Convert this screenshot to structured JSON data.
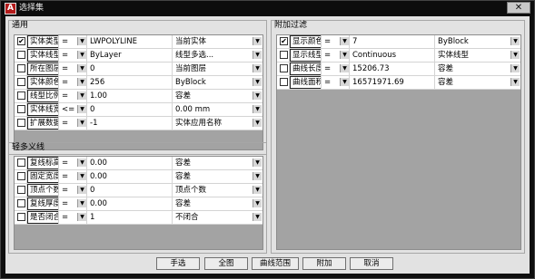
{
  "title": "选择集",
  "general": {
    "title": "通用",
    "rows": [
      {
        "checked": true,
        "property": "实体类型",
        "op": "=",
        "value": "LWPOLYLINE",
        "option": "当前实体"
      },
      {
        "checked": false,
        "property": "实体线型",
        "op": "=",
        "value": "ByLayer",
        "option": "线型多选..."
      },
      {
        "checked": false,
        "property": "所在图层",
        "op": "=",
        "value": "0",
        "option": "当前图层"
      },
      {
        "checked": false,
        "property": "实体颜色",
        "op": "=",
        "value": "256",
        "option": "ByBlock"
      },
      {
        "checked": false,
        "property": "线型比例",
        "op": "=",
        "value": "1.00",
        "option": "容差"
      },
      {
        "checked": false,
        "property": "实体线宽",
        "op": "<=",
        "value": "0",
        "option": "0.00 mm"
      },
      {
        "checked": false,
        "property": "扩展数据",
        "op": "=",
        "value": "-1",
        "option": "实体应用名称"
      }
    ]
  },
  "polyline": {
    "title": "轻多义线",
    "rows": [
      {
        "checked": false,
        "property": "复线标高",
        "op": "=",
        "value": "0.00",
        "option": "容差"
      },
      {
        "checked": false,
        "property": "固定宽度",
        "op": "=",
        "value": "0.00",
        "option": "容差"
      },
      {
        "checked": false,
        "property": "顶点个数",
        "op": "=",
        "value": "0",
        "option": "顶点个数"
      },
      {
        "checked": false,
        "property": "复线厚度",
        "op": "=",
        "value": "0.00",
        "option": "容差"
      },
      {
        "checked": false,
        "property": "是否闭合",
        "op": "=",
        "value": "1",
        "option": "不闭合"
      }
    ]
  },
  "extra": {
    "title": "附加过滤",
    "rows": [
      {
        "checked": true,
        "property": "显示颜色",
        "op": "=",
        "value": "7",
        "option": "ByBlock"
      },
      {
        "checked": false,
        "property": "显示线型",
        "op": "=",
        "value": "Continuous",
        "option": "实体线型"
      },
      {
        "checked": false,
        "property": "曲线长度",
        "op": "=",
        "value": "15206.73",
        "option": "容差"
      },
      {
        "checked": false,
        "property": "曲线面积",
        "op": "=",
        "value": "16571971.69",
        "option": "容差"
      }
    ]
  },
  "buttons": [
    "手选",
    "全图",
    "曲线范围",
    "附加",
    "取消"
  ],
  "close_glyph": "✕",
  "app_icon_glyph": "A",
  "check_glyph": "✔",
  "dropdown_glyph": "▼",
  "colors": {
    "titlebar": "#0d0d0d",
    "client": "#e2e2e2",
    "grid_bg": "#a3a3a3",
    "app_icon": "#b31b1b"
  }
}
